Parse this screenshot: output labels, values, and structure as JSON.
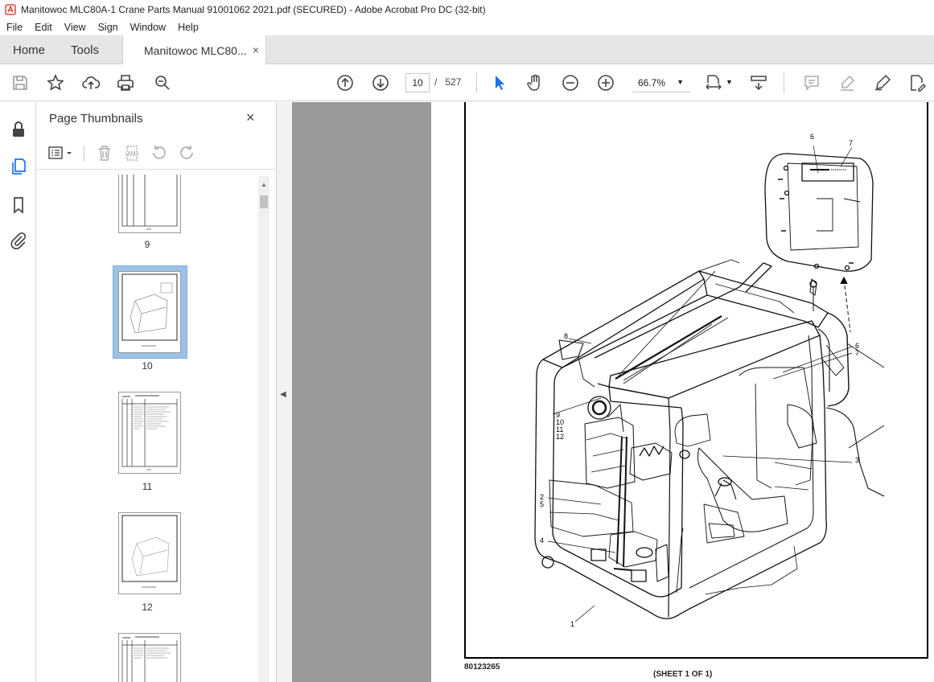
{
  "window": {
    "title": "Manitowoc MLC80A-1 Crane Parts Manual 91001062 2021.pdf (SECURED) - Adobe Acrobat Pro DC (32-bit)"
  },
  "menu": [
    "File",
    "Edit",
    "View",
    "Sign",
    "Window",
    "Help"
  ],
  "tabs": {
    "home": "Home",
    "tools": "Tools",
    "document": "Manitowoc MLC80...",
    "close_glyph": "×"
  },
  "toolbar": {
    "current_page": "10",
    "separator": "/",
    "total_pages": "527",
    "zoom": "66.7%"
  },
  "thumbnail_panel": {
    "title": "Page Thumbnails",
    "close_glyph": "×",
    "pages": [
      {
        "number": "9"
      },
      {
        "number": "10",
        "selected": true
      },
      {
        "number": "11"
      },
      {
        "number": "12"
      },
      {
        "number": ""
      }
    ]
  },
  "document": {
    "part_number": "80123265",
    "sheet_label": "(SHEET 1 OF 1)",
    "callouts": [
      "1",
      "2",
      "3",
      "4",
      "5",
      "6",
      "7",
      "8",
      "9",
      "10",
      "11",
      "12"
    ]
  },
  "colors": {
    "selection": "#9cc2e5",
    "doc_background": "#9a9a9a",
    "accent_blue": "#1a73e8"
  }
}
